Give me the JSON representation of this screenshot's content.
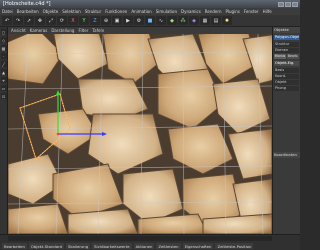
{
  "window": {
    "title": "[Holzscheite.c4d *]"
  },
  "menubar": {
    "items": [
      "Datei",
      "Bearbeiten",
      "Objekte",
      "Selektion",
      "Struktur",
      "Funktionen",
      "Animation",
      "Simulation",
      "Dynamics",
      "Rendern",
      "Plugins",
      "Fenster",
      "Hilfe"
    ]
  },
  "toolbar": {
    "icons": [
      "undo-icon",
      "redo-icon",
      "cursor-icon",
      "move-icon",
      "scale-icon",
      "rotate-icon",
      "x-axis-icon",
      "y-axis-icon",
      "z-axis-icon",
      "coordinate-icon",
      "render-view-icon",
      "render-icon",
      "render-settings-icon",
      "cube-icon",
      "spline-icon",
      "nurbs-icon",
      "array-icon",
      "deformer-icon",
      "scene-icon",
      "camera-icon",
      "light-icon"
    ]
  },
  "viewport": {
    "menu": [
      "Ansicht",
      "Kameras",
      "Darstellung",
      "Filter",
      "Tafeln"
    ],
    "accent": "#3a3aff"
  },
  "right_panel": {
    "objects_header": "Objekte",
    "selected_object": "Polygon-Objekt",
    "rows": [
      "Struktur",
      "Ebenen"
    ],
    "tabs": [
      "Modus",
      "Bearb."
    ],
    "attr_header": "Objekt-Eig.",
    "attr_rows": [
      "Basis",
      "Koord.",
      "Objekt",
      "Phong"
    ],
    "bottom_header": "Koordinaten"
  },
  "timeline": {
    "buttons": [
      "Bearbeiten",
      "Objekt-Standard",
      "Skalierung",
      "Sichtbarkeitswerte",
      "Aktionen",
      "Zeitleisten",
      "Eigenschaften",
      "Zeitleiste-Position"
    ]
  }
}
